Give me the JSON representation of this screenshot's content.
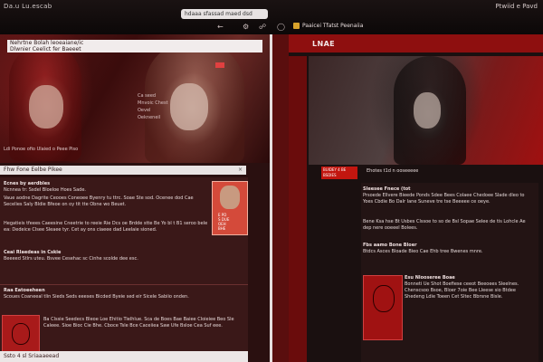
{
  "window": {
    "title_left": "Da.u Lu.escab",
    "title_right": "Ptwiid e Pavd",
    "url": "hdaaa sfassad maed dsd"
  },
  "toolbar": {
    "icons": [
      "back-icon",
      "gear-icon",
      "bookmark-icon",
      "notification-icon"
    ]
  },
  "right_tab": {
    "label": "Paaicei Tfatst Peenaiia"
  },
  "left_pane": {
    "hero_title": "Nehrtne Bolah leoeaiane/ic\nDlwnier Ceelict fer Baeeet",
    "hero_side_text": [
      "Ca seed",
      "Mnvoic Chest",
      "Oevel",
      "Oekneneil"
    ],
    "hero_foot": "Ldi Ponoe ofio Ulaied o Peee Piso",
    "section_bar_label": "Fhw Fone Eelbe Pikee",
    "paragraphs": [
      {
        "head": "Ecnes by aerdbles",
        "text": "Ncnnea tr: Ssdel Bloeloe Hoes Sade."
      },
      {
        "head": "",
        "text": "Vaue aodne Dagrite Ceooes Coneoee Byenry tu ttrc. Soae Ste sod. Ocenee dod Cae Secelies Saly Bldie Bfeoe on oy tit tte Obne wo Beuet."
      },
      {
        "head": "",
        "text": "Hegatieis tfeees Caeesine Cneetrie to reeie Rie Dcs oe Brdde stte Be Yo bl t B1 seroo bele ea: Dedeice Clsee Sleaee tyr. Cet ay ons ciaeee dad Leelaie sioned."
      },
      {
        "head": "Ceai Rlaedeas in Cskie",
        "text": "Beeeed Stlrs uteu. Bsvee Cesehac sc Cinhe scolde dee esc."
      },
      {
        "head": "Raa Eatoeeheen",
        "text": "Scoues Coaneeal tlin Sieds Seds eeeses Bicded Byeie sed eir Sicele Sabiio onden."
      },
      {
        "head": "",
        "text": "Ba Clssie Seedecs Bleoe Loe Ehitio Tielhlue. Sca de Boes Bae Baiee Cloieiee Beo Sle Caleee. Sioe Bioc Cie Bhe. Cboce Tsle Bce Caceiiea Saw Ufe Bsloe Cea Suf eee."
      }
    ],
    "profile_lines": [
      "E PD",
      "S DUE",
      "OEH",
      "BHE"
    ],
    "footer_label": "Ssto 4 sl Sriaaaeead"
  },
  "right_pane": {
    "logo": "LNAE",
    "subbar_text": "BUIDEY 4 BE BSDIES",
    "subhead": "Ehotes t1d n ooseeeee",
    "paragraphs": [
      {
        "head": "Sleesee Fnece (tot",
        "text": "Prsoede Ellvere Bieede Ponds Sdee Bees Colaee Chedoee Slade dleo to Yoes Cbdie Bo Dalr Iane Suneve tre tse Beeeee ce oeye."
      },
      {
        "head": "",
        "text": "Bene Ksa hse Bt Usbes Clssoe to so de Bsl Sopae Selee de tis Lohcle Ae dep nere ooeeel Bolees."
      },
      {
        "head": "Fbs aamo Bone Bloer",
        "text": "Btdcs Asces Bloade Bieo Cae Ehb tree Bwenes mnre."
      },
      {
        "head": "Esu Nlooseree Boae",
        "text": "Bonneti Ue Shot Boefiese ceeot Beeoees Sleelnes. Chenscsoo Bsoe, Bloer 7oie Bee Lleese sio Btdee Shedeng Ldie Toeen Cet Sltec Bbrsne Bisle."
      }
    ]
  },
  "colors": {
    "accent_red": "#8e0f0f",
    "bright_red": "#c2160f",
    "page_dark": "#120606",
    "panel_light": "#e9e4e4"
  }
}
